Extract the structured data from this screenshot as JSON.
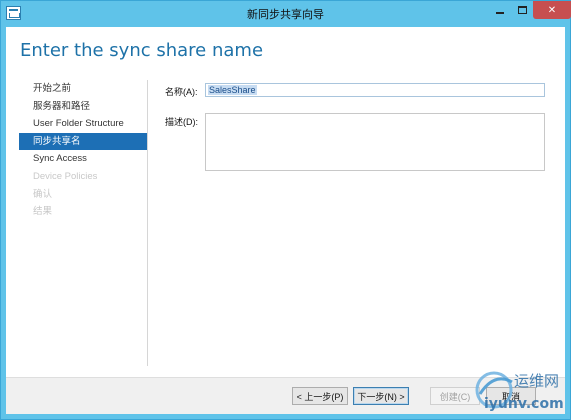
{
  "window": {
    "title": "新同步共享向导",
    "controls": {
      "minimize": "minimize-icon",
      "maximize": "maximize-icon",
      "close": "close-icon"
    }
  },
  "header": {
    "title": "Enter the sync share name"
  },
  "nav": {
    "items": [
      {
        "label": "开始之前",
        "state": "normal"
      },
      {
        "label": "服务器和路径",
        "state": "normal"
      },
      {
        "label": "User Folder Structure",
        "state": "normal"
      },
      {
        "label": "同步共享名",
        "state": "selected"
      },
      {
        "label": "Sync Access",
        "state": "normal"
      },
      {
        "label": "Device Policies",
        "state": "disabled"
      },
      {
        "label": "确认",
        "state": "disabled"
      },
      {
        "label": "结果",
        "state": "disabled"
      }
    ]
  },
  "form": {
    "name_label": "名称(A):",
    "name_value": "SalesShare",
    "description_label": "描述(D):",
    "description_value": ""
  },
  "footer": {
    "prev_label": "< 上一步(P)",
    "next_label": "下一步(N) >",
    "create_label": "创建(C)",
    "cancel_label": "取消"
  },
  "watermark": {
    "text_cn": "运维网",
    "text_url": "iyunv.com"
  },
  "colors": {
    "titlebar": "#5fc3e9",
    "accent": "#1e72a8",
    "selected_nav": "#1d6fb5",
    "close_button": "#c74f50"
  }
}
